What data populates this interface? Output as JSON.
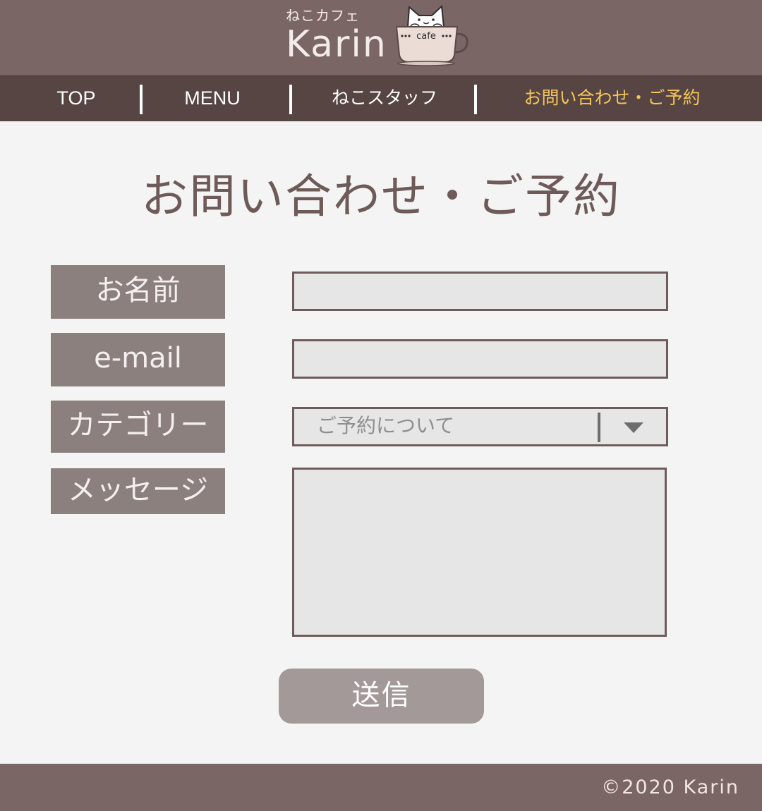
{
  "header": {
    "logo_sub": "ねこカフェ",
    "logo_main": "Karin",
    "cup_text": "cafe",
    "cup_icon": "cat-in-coffee-cup-icon"
  },
  "nav": {
    "items": [
      {
        "label": "TOP"
      },
      {
        "label": "MENU"
      },
      {
        "label": "ねこスタッフ"
      },
      {
        "label": "お問い合わせ・ご予約",
        "active": true
      }
    ]
  },
  "page": {
    "title": "お問い合わせ・ご予約"
  },
  "form": {
    "name_label": "お名前",
    "name_value": "",
    "email_label": "e-mail",
    "email_value": "",
    "category_label": "カテゴリー",
    "category_selected": "ご予約について",
    "message_label": "メッセージ",
    "message_value": "",
    "submit_label": "送信"
  },
  "footer": {
    "copyright": "©2020 Karin"
  },
  "colors": {
    "header_bg": "#7a6664",
    "nav_bg": "#574544",
    "nav_active": "#f5c55a",
    "label_bg": "#8c807f",
    "submit_bg": "#a29998",
    "page_bg": "#f4f4f4"
  }
}
